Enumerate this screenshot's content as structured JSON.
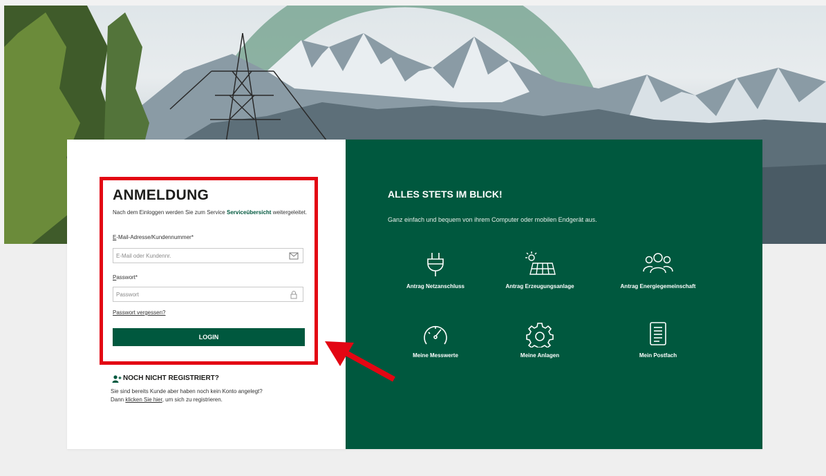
{
  "login": {
    "title": "ANMELDUNG",
    "intro_prefix": "Nach dem Einloggen werden Sie zum Service ",
    "intro_link": "Serviceübersicht",
    "intro_suffix": " weitergeleitet.",
    "email_label_u": "E",
    "email_label_rest": "-Mail-Adresse/Kundennummer*",
    "email_placeholder": "E-Mail oder Kundennr.",
    "password_label_u": "P",
    "password_label_rest": "asswort*",
    "password_placeholder": "Passwort",
    "forgot_link": "Passwort vergessen?",
    "login_button": "LOGIN"
  },
  "register": {
    "title": "NOCH NICHT REGISTRIERT?",
    "line1": "Sie sind bereits Kunde aber haben noch kein Konto angelegt?",
    "line2_prefix": "Dann ",
    "line2_link": "klicken Sie hier",
    "line2_suffix": ", um sich zu registrieren."
  },
  "promo": {
    "title": "ALLES STETS IM BLICK!",
    "subtitle": "Ganz einfach und bequem von ihrem Computer oder mobilen Endgerät aus.",
    "tiles": [
      {
        "label": "Antrag Netzanschluss",
        "icon": "plug-icon"
      },
      {
        "label": "Antrag Erzeugungsanlage",
        "icon": "solar-panel-icon"
      },
      {
        "label": "Antrag Energiegemeinschaft",
        "icon": "community-icon"
      },
      {
        "label": "Meine Messwerte",
        "icon": "gauge-icon"
      },
      {
        "label": "Meine Anlagen",
        "icon": "gear-icon"
      },
      {
        "label": "Mein Postfach",
        "icon": "document-icon"
      }
    ]
  },
  "colors": {
    "brand_green": "#00583e",
    "highlight_red": "#e30613"
  }
}
